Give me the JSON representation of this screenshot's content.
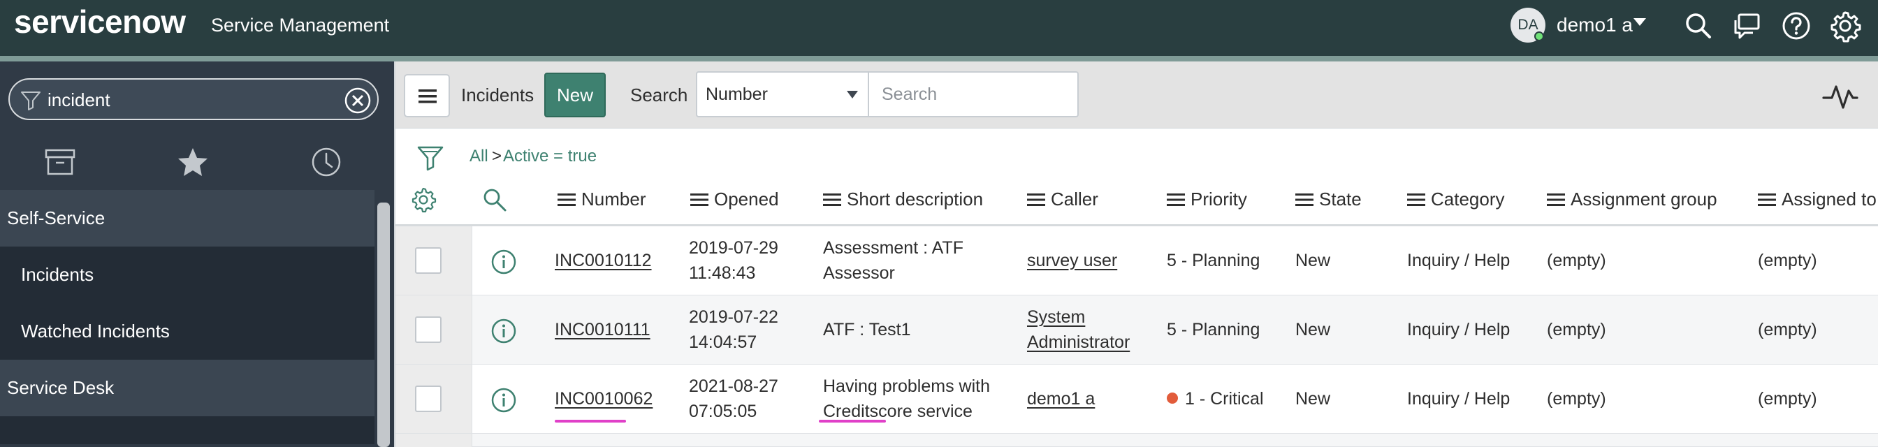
{
  "banner": {
    "logo": "servicenow",
    "app_title": "Service Management",
    "user_initials": "DA",
    "user_name": "demo1 a",
    "icons": [
      "search-icon",
      "chat-icon",
      "help-icon",
      "gear-icon"
    ]
  },
  "nav": {
    "filter_value": "incident",
    "tabs": [
      "archive-icon",
      "star-icon",
      "history-icon"
    ],
    "modules": [
      {
        "label": "Self-Service",
        "items": [
          "Incidents",
          "Watched Incidents"
        ]
      },
      {
        "label": "Service Desk",
        "items": []
      }
    ]
  },
  "list": {
    "title": "Incidents",
    "new_label": "New",
    "search_label": "Search",
    "search_field": "Number",
    "search_placeholder": "Search",
    "breadcrumb_all": "All",
    "breadcrumb_sep": ">",
    "breadcrumb_filter": "Active = true",
    "columns": [
      "Number",
      "Opened",
      "Short description",
      "Caller",
      "Priority",
      "State",
      "Category",
      "Assignment group",
      "Assigned to"
    ],
    "rows": [
      {
        "number": "INC0010112",
        "opened_date": "2019-07-29",
        "opened_time": "11:48:43",
        "desc_1": "Assessment : ATF",
        "desc_2": "Assessor",
        "caller_1": "survey user",
        "caller_2": "",
        "priority": "5 - Planning",
        "state": "New",
        "category": "Inquiry / Help",
        "group": "(empty)",
        "assigned": "(empty)"
      },
      {
        "number": "INC0010111",
        "opened_date": "2019-07-22",
        "opened_time": "14:04:57",
        "desc_1": "ATF : Test1",
        "desc_2": "",
        "caller_1": "System",
        "caller_2": "Administrator",
        "priority": "5 - Planning",
        "state": "New",
        "category": "Inquiry / Help",
        "group": "(empty)",
        "assigned": "(empty)"
      },
      {
        "number": "INC0010062",
        "opened_date": "2021-08-27",
        "opened_time": "07:05:05",
        "desc_1": "Having problems with",
        "desc_2": "Creditscore service",
        "caller_1": "demo1 a",
        "caller_2": "",
        "priority": "1 - Critical",
        "state": "New",
        "category": "Inquiry / Help",
        "group": "(empty)",
        "assigned": "(empty)"
      }
    ]
  },
  "colors": {
    "banner": "#293e40",
    "nav_bg": "#303a46",
    "accent_green": "#3e8170",
    "critical": "#e25c3b",
    "spellcheck": "#e040c8"
  }
}
